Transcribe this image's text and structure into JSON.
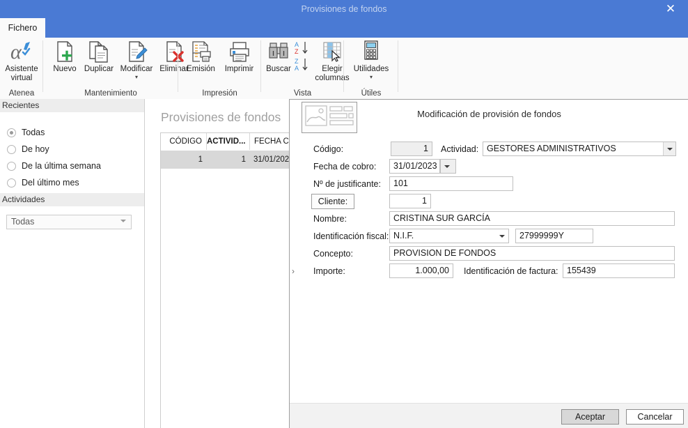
{
  "window": {
    "title": "Provisiones de fondos",
    "close_label": "✕"
  },
  "tabs": [
    {
      "label": "Fichero"
    }
  ],
  "ribbon": {
    "groups": [
      {
        "title": "Atenea",
        "buttons": [
          {
            "label": "Asistente\nvirtual",
            "icon": "atenea-alpha-icon"
          }
        ]
      },
      {
        "title": "Mantenimiento",
        "buttons": [
          {
            "label": "Nuevo",
            "icon": "new-document-icon"
          },
          {
            "label": "Duplicar",
            "icon": "duplicate-document-icon"
          },
          {
            "label": "Modificar",
            "icon": "edit-document-icon",
            "caret": "▾"
          },
          {
            "label": "Eliminar",
            "icon": "delete-document-icon"
          }
        ]
      },
      {
        "title": "Impresión",
        "buttons": [
          {
            "label": "Emisión",
            "icon": "report-emission-icon"
          },
          {
            "label": "Imprimir",
            "icon": "printer-icon"
          }
        ]
      },
      {
        "title": "Vista",
        "buttons": [
          {
            "label": "Buscar",
            "icon": "binoculars-icon"
          },
          {
            "label": "sort-az",
            "icon": "sort-ascending-icon"
          },
          {
            "label": "sort-za",
            "icon": "sort-descending-icon"
          },
          {
            "label": "Elegir\ncolumnas",
            "icon": "choose-columns-icon"
          }
        ]
      },
      {
        "title": "Útiles",
        "buttons": [
          {
            "label": "Utilidades",
            "icon": "calculator-icon",
            "caret": "▾"
          }
        ]
      }
    ],
    "labels": {
      "asistente_line1": "Asistente",
      "asistente_line2": "virtual",
      "nuevo": "Nuevo",
      "duplicar": "Duplicar",
      "modificar": "Modificar",
      "eliminar": "Eliminar",
      "emision": "Emisión",
      "imprimir": "Imprimir",
      "buscar": "Buscar",
      "elegir_line1": "Elegir",
      "elegir_line2": "columnas",
      "utilidades": "Utilidades",
      "grp_atenea": "Atenea",
      "grp_mantenimiento": "Mantenimiento",
      "grp_impresion": "Impresión",
      "grp_vista": "Vista",
      "grp_utiles": "Útiles",
      "caret": "▾"
    }
  },
  "sidebar": {
    "recientes_header": "Recientes",
    "recientes_options": [
      {
        "label": "Todas",
        "selected": true
      },
      {
        "label": "De hoy",
        "selected": false
      },
      {
        "label": "De la última semana",
        "selected": false
      },
      {
        "label": "Del último mes",
        "selected": false
      }
    ],
    "actividades_header": "Actividades",
    "actividades_value": "Todas"
  },
  "grid": {
    "title": "Provisiones de fondos",
    "columns": [
      "CÓDIGO",
      "ACTIVID...",
      "FECHA C"
    ],
    "rows": [
      {
        "codigo": "1",
        "actividad": "1",
        "fecha": "31/01/202"
      }
    ]
  },
  "dialog": {
    "title": "Modificación de provisión de fondos",
    "fields": {
      "codigo_label": "Código:",
      "codigo_value": "1",
      "actividad_label": "Actividad:",
      "actividad_value": "GESTORES ADMINISTRATIVOS",
      "fecha_label": "Fecha de cobro:",
      "fecha_value": "31/01/2023",
      "justificante_label": "Nº de justificante:",
      "justificante_value": "101",
      "cliente_label": "Cliente:",
      "cliente_value": "1",
      "nombre_label": "Nombre:",
      "nombre_value": "CRISTINA SUR GARCÍA",
      "identificacion_label": "Identificación fiscal:",
      "identificacion_tipo": "N.I.F.",
      "identificacion_value": "27999999Y",
      "concepto_label": "Concepto:",
      "concepto_value": "PROVISION DE FONDOS",
      "importe_label": "Importe:",
      "importe_value": "1.000,00",
      "importe_marker": "›",
      "factura_label": "Identificación de factura:",
      "factura_value": "155439"
    },
    "footer": {
      "accept_label": "Aceptar",
      "cancel_label": "Cancelar"
    }
  },
  "colors": {
    "title_blue": "#4a7ad4",
    "ribbon_bg": "#fafafa",
    "grid_selected_row": "#d8d8d8",
    "accent_green": "#2da84f",
    "accent_red": "#d9302c",
    "accent_blue": "#3c8fd8"
  }
}
